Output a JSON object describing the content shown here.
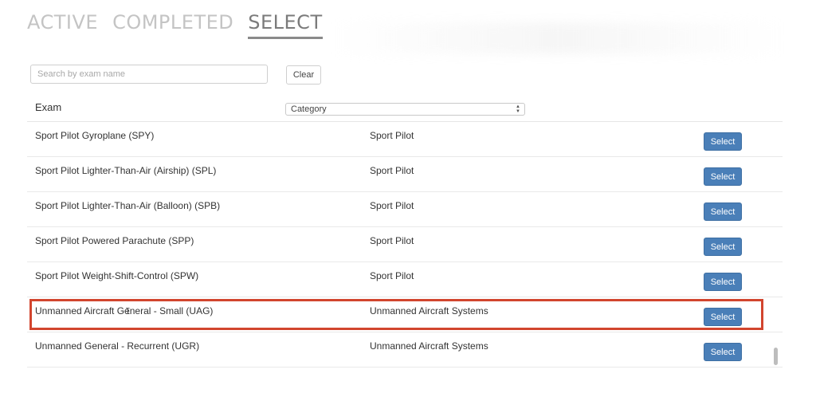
{
  "tabs": [
    {
      "label": "ACTIVE",
      "active": false
    },
    {
      "label": "COMPLETED",
      "active": false
    },
    {
      "label": "SELECT",
      "active": true
    }
  ],
  "search": {
    "placeholder": "Search by exam name",
    "value": ""
  },
  "clear_label": "Clear",
  "columns": {
    "exam": "Exam",
    "category_select": "Category"
  },
  "rows": [
    {
      "name": "Sport Pilot Gyroplane (SPY)",
      "category": "Sport Pilot",
      "action": "Select"
    },
    {
      "name": "Sport Pilot Lighter-Than-Air (Airship) (SPL)",
      "category": "Sport Pilot",
      "action": "Select"
    },
    {
      "name": "Sport Pilot Lighter-Than-Air (Balloon) (SPB)",
      "category": "Sport Pilot",
      "action": "Select"
    },
    {
      "name": "Sport Pilot Powered Parachute (SPP)",
      "category": "Sport Pilot",
      "action": "Select"
    },
    {
      "name": "Sport Pilot Weight-Shift-Control (SPW)",
      "category": "Sport Pilot",
      "action": "Select"
    },
    {
      "name": "Unmanned Aircraft General - Small (UAG)",
      "category": "Unmanned Aircraft Systems",
      "action": "Select",
      "highlighted": true
    },
    {
      "name": "Unmanned General - Recurrent (UGR)",
      "category": "Unmanned Aircraft Systems",
      "action": "Select"
    }
  ],
  "colors": {
    "accent": "#4a7fb8",
    "highlight": "#d2452e"
  },
  "icons": {
    "cursor": "text-cursor-icon",
    "select_arrows": "updown-arrows-icon"
  }
}
